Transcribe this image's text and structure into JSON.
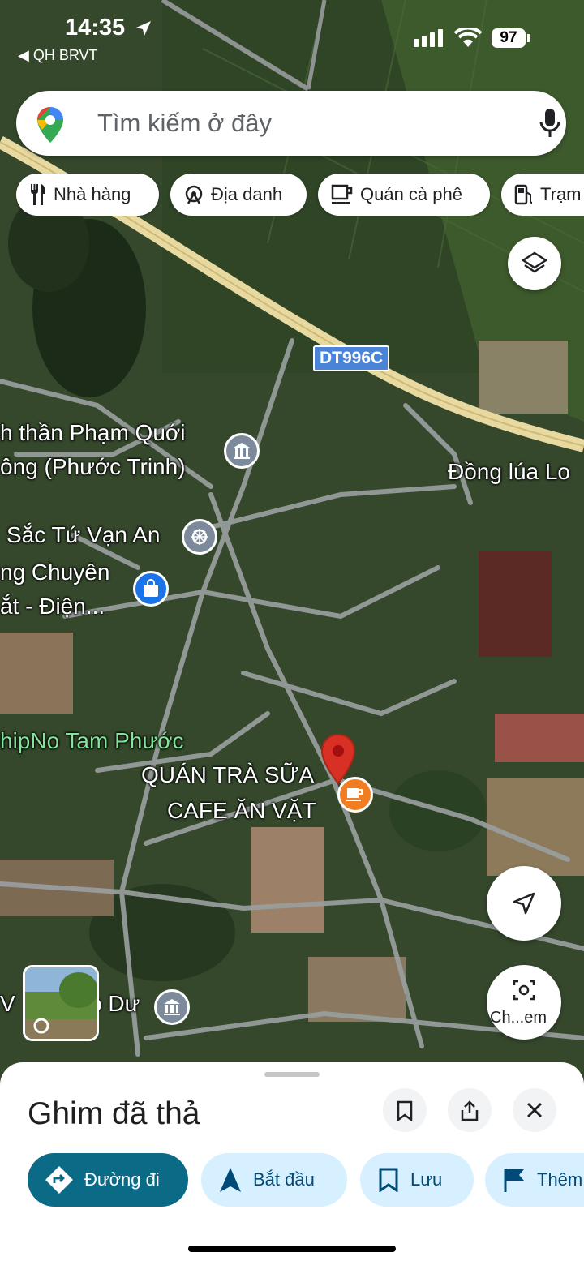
{
  "status_bar": {
    "time": "14:35",
    "back_app": "◀ QH BRVT",
    "battery": "97"
  },
  "search": {
    "placeholder": "Tìm kiếm ở đây"
  },
  "chips": [
    {
      "label": "Nhà hàng",
      "icon": "restaurant-icon"
    },
    {
      "label": "Địa danh",
      "icon": "landmark-icon"
    },
    {
      "label": "Quán cà phê",
      "icon": "coffee-icon"
    },
    {
      "label": "Trạm",
      "icon": "gas-station-icon"
    }
  ],
  "map": {
    "road_badge": "DT996C",
    "labels": {
      "l1a": "h thần Phạm Quới",
      "l1b": "ông (Phước Trinh)",
      "l2": "Đồng lúa Lo",
      "l3": "Sắc Tứ Vạn An",
      "l4a": "ng Chuyên",
      "l4b": "ắt - Điện...",
      "l5": "hipNo Tam Phước",
      "l6a": "QUÁN TRÀ SỮA",
      "l6b": "CAFE ĂN VẶT",
      "l7a": "V",
      "l7b": "o Dư"
    },
    "camera_label": "Ch...em"
  },
  "sheet": {
    "title": "Ghim đã thả",
    "actions": [
      {
        "label": "Đường đi"
      },
      {
        "label": "Bắt đầu"
      },
      {
        "label": "Lưu"
      },
      {
        "label": "Thêm"
      }
    ]
  },
  "colors": {
    "primary": "#0b6a86",
    "tonal": "#d7f0ff",
    "road_badge": "#4a84d8",
    "pin": "#d93025",
    "cafe_poi": "#f27c21"
  }
}
